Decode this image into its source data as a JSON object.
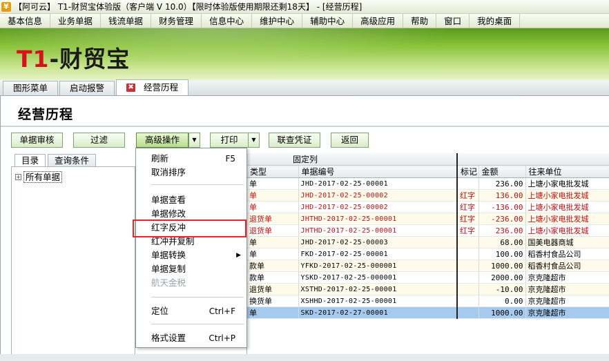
{
  "window": {
    "title": "【阿可云】 T1-财贸宝体验版（客户端 V 10.0）【限时体验版使用期限还剩18天】 - [经营历程]"
  },
  "menubar": [
    "基本信息",
    "业务单据",
    "钱流单据",
    "财务管理",
    "信息中心",
    "维护中心",
    "辅助中心",
    "高级应用",
    "帮助",
    "窗口",
    "我的桌面"
  ],
  "brand": {
    "t1": "T1",
    "dash": "-",
    "cn": "财贸宝"
  },
  "tabs": [
    {
      "label": "图形菜单"
    },
    {
      "label": "启动报警"
    },
    {
      "label": "经营历程",
      "close": "✖"
    }
  ],
  "page": {
    "title": "经营历程"
  },
  "toolbar": {
    "audit": "单据审核",
    "filter": "过滤",
    "advanced": "高级操作",
    "print": "打印",
    "voucher": "联查凭证",
    "back": "返回",
    "arrow": "▼"
  },
  "left_tabs": [
    "目录",
    "查询条件"
  ],
  "tree": {
    "expander": "+",
    "root": "所有单据"
  },
  "grid": {
    "fixed_header": "固定列",
    "columns": [
      "类型",
      "单据编号",
      "标记",
      "金额",
      "往来单位"
    ],
    "rows": [
      {
        "type": "单",
        "code": "JHD-2017-02-25-00001",
        "mark": "",
        "amount": "236.00",
        "party": "上塘小家电批发城"
      },
      {
        "type": "单",
        "code": "JHD-2017-02-25-00002",
        "mark": "红字",
        "amount": "136.00",
        "party": "上塘小家电批发城"
      },
      {
        "type": "单",
        "code": "JHD-2017-02-25-00002",
        "mark": "红字",
        "amount": "-136.00",
        "party": "上塘小家电批发城"
      },
      {
        "type": "退货单",
        "code": "JHTHD-2017-02-25-00001",
        "mark": "红字",
        "amount": "-236.00",
        "party": "上塘小家电批发城"
      },
      {
        "type": "退货单",
        "code": "JHTHD-2017-02-25-00001",
        "mark": "红字",
        "amount": "236.00",
        "party": "上塘小家电批发城"
      },
      {
        "type": "单",
        "code": "JHD-2017-02-25-00003",
        "mark": "",
        "amount": "68.00",
        "party": "国美电器商城"
      },
      {
        "type": "单",
        "code": "FKD-2017-02-25-00001",
        "mark": "",
        "amount": "100.00",
        "party": "稻香村食品公司"
      },
      {
        "type": "款单",
        "code": "YFKD-2017-02-25-000001",
        "mark": "",
        "amount": "1000.00",
        "party": "稻香村食品公司"
      },
      {
        "type": "款单",
        "code": "YSKD-2017-02-25-000001",
        "mark": "",
        "amount": "2000.00",
        "party": "京克隆超市"
      },
      {
        "type": "退货单",
        "code": "XSTHD-2017-02-25-00001",
        "mark": "",
        "amount": "-10.00",
        "party": "京克隆超市"
      },
      {
        "type": "换货单",
        "code": "XSHHD-2017-02-25-00001",
        "mark": "",
        "amount": "0.00",
        "party": "京克隆超市"
      },
      {
        "type": "单",
        "code": "SKD-2017-02-27-00001",
        "mark": "",
        "amount": "1000.00",
        "party": "京克隆超市"
      }
    ]
  },
  "context_menu": {
    "refresh": "刷新",
    "refresh_sc": "F5",
    "cancel_sort": "取消排序",
    "view": "单据查看",
    "edit": "单据修改",
    "red_reverse": "红字反冲",
    "red_copy": "红冲并复制",
    "convert": "单据转换",
    "convert_arrow": "▶",
    "copy": "单据复制",
    "tax": "航天金税",
    "locate": "定位",
    "locate_sc": "Ctrl+F",
    "format": "格式设置",
    "format_sc": "Ctrl+P"
  }
}
